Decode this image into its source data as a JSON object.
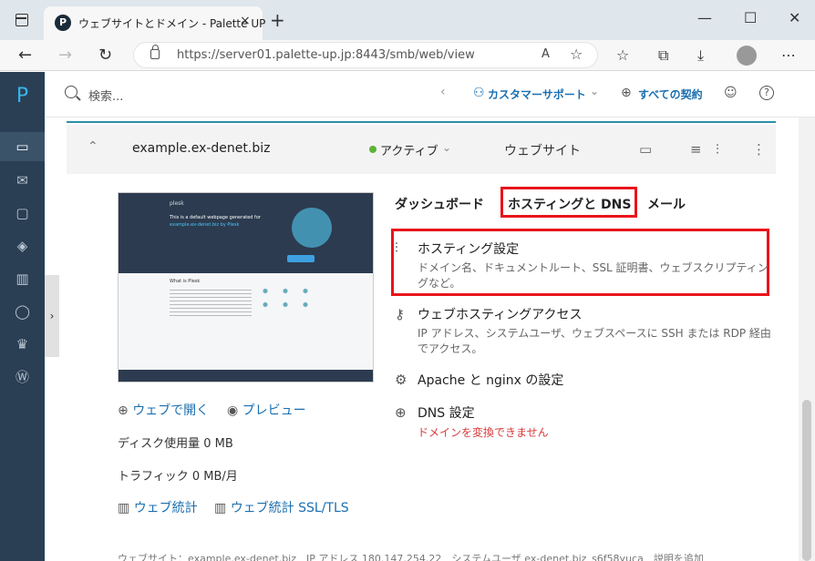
{
  "browser": {
    "tab_favicon": "P",
    "tab_title": "ウェブサイトとドメイン - Palette UP",
    "tab_close": "×",
    "new_tab": "+",
    "minimize": "—",
    "maximize": "☐",
    "close": "✕",
    "back": "←",
    "forward": "→",
    "reload": "↻",
    "url": "https://server01.palette-up.jp:8443/smb/web/view",
    "read_aloud": "A",
    "favorites_add": "☆",
    "favorites": "☆",
    "collections": "⧉",
    "downloads": "⤓",
    "more": "⋯"
  },
  "sidebar": {
    "logo": "P",
    "icons": [
      "monitor-icon",
      "mail-icon",
      "folder-icon",
      "layers-icon",
      "chart-icon",
      "user-icon",
      "crown-icon",
      "wordpress-icon"
    ],
    "glyphs": [
      "▭",
      "✉",
      "▢",
      "◈",
      "▥",
      "◯",
      "♛",
      "Ⓦ"
    ],
    "collapse": "›"
  },
  "header": {
    "search_placeholder": "検索...",
    "chevron": "‹",
    "support_label": "カスタマーサポート",
    "support_chev": "⌄",
    "subscriptions_label": "すべての契約",
    "globe": "⊕",
    "smiley": "☺",
    "help": "?"
  },
  "site": {
    "domain": "example.ex-denet.biz",
    "chevron_up": "⌃",
    "status": "アクティブ",
    "status_chev": "⌄",
    "type_label": "ウェブサイト",
    "folder": "▭",
    "db": "≡",
    "sliders": "⫶",
    "more": "⋮",
    "open_link": "ウェブで開く",
    "preview_link": "プレビュー",
    "disk_usage": "ディスク使用量 0 MB",
    "traffic": "トラフィック 0 MB/月",
    "web_stats": "ウェブ統計",
    "web_stats_ssl": "ウェブ統計 SSL/TLS"
  },
  "tabs": {
    "dashboard": "ダッシュボード",
    "hosting_dns": "ホスティングと DNS",
    "mail": "メール"
  },
  "items": [
    {
      "title": "ホスティング設定",
      "desc": "ドメイン名、ドキュメントルート、SSL 証明書、ウェブスクリプティングなど。",
      "icon": "⫶"
    },
    {
      "title": "ウェブホスティングアクセス",
      "desc": "IP アドレス、システムユーザ、ウェブスペースに SSH または RDP 経由でアクセス。",
      "icon": "⚷"
    },
    {
      "title": "Apache と nginx の設定",
      "desc": "",
      "icon": "⚙"
    },
    {
      "title": "DNS 設定",
      "desc": "ドメインを変換できません",
      "icon": "⊕"
    }
  ],
  "thumb": {
    "brand": "plesk",
    "heading": "This is a default webpage generated for",
    "heading2": "example.ex-denet.biz by Plesk",
    "section": "What is Plesk"
  },
  "footer": "ウェブサイト：example.ex-denet.biz　IP アドレス 180.147.254.22　システムユーザ ex-denet.biz_s6f58yuca　説明を追加"
}
